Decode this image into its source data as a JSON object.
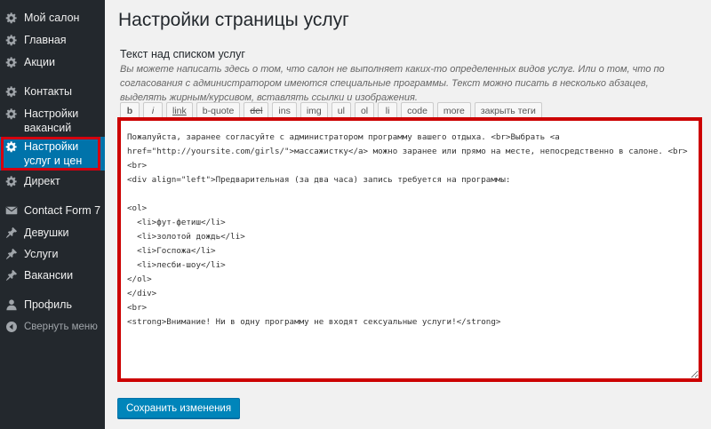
{
  "sidebar": {
    "items": [
      {
        "label": "Мой салон",
        "icon": "gear-icon"
      },
      {
        "label": "Главная",
        "icon": "gear-icon"
      },
      {
        "label": "Акции",
        "icon": "gear-icon"
      },
      {
        "label": "Контакты",
        "icon": "gear-icon"
      },
      {
        "label": "Настройки вакансий",
        "icon": "gear-icon"
      },
      {
        "label": "Настройки услуг и цен",
        "icon": "gear-icon",
        "active": true
      },
      {
        "label": "Директ",
        "icon": "gear-icon"
      },
      {
        "label": "Contact Form 7",
        "icon": "mail-icon"
      },
      {
        "label": "Девушки",
        "icon": "pin-icon"
      },
      {
        "label": "Услуги",
        "icon": "pin-icon"
      },
      {
        "label": "Вакансии",
        "icon": "pin-icon"
      },
      {
        "label": "Профиль",
        "icon": "user-icon"
      },
      {
        "label": "Свернуть меню",
        "icon": "collapse-icon"
      }
    ]
  },
  "main": {
    "title": "Настройки страницы услуг",
    "section_label": "Текст над списком услуг",
    "section_desc": "Вы можете написать здесь о том, что салон не выполняет каких-то определенных видов услуг. Или о том, что по согласования с администратором имеются специальные программы. Текст можно писать в несколько абзацев, выделять жирным/курсивом, вставлять ссылки и изображения.",
    "toolbar": [
      "b",
      "i",
      "link",
      "b-quote",
      "del",
      "ins",
      "img",
      "ul",
      "ol",
      "li",
      "code",
      "more",
      "закрыть теги"
    ],
    "editor_content": "Пожалуйста, заранее согласуйте с администратором программу вашего отдыха. <br>Выбрать <a\nhref=\"http://yoursite.com/girls/\">массажистку</a> можно заранее или прямо на месте, непосредственно в салоне. <br>\n<br>\n<div align=\"left\">Предварительная (за два часа) запись требуется на программы:\n\n<ol>\n  <li>фут-фетиш</li>\n  <li>золотой дождь</li>\n  <li>Госпожа</li>\n  <li>лесби-шоу</li>\n</ol>\n</div>\n<br>\n<strong>Внимание! Ни в одну программу не входят сексуальные услуги!</strong>",
    "save_label": "Сохранить изменения"
  },
  "colors": {
    "sidebar_bg": "#23282d",
    "active_bg": "#0073aa",
    "highlight": "#cc0000",
    "primary_button": "#0085ba"
  }
}
